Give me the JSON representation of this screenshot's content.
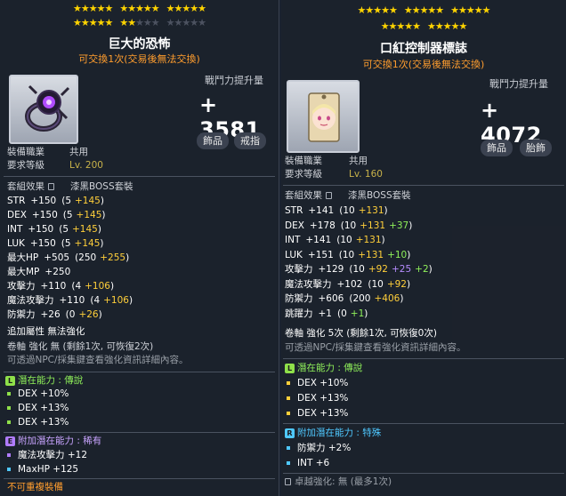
{
  "left": {
    "stars_row1": [
      "★★★★★",
      "★★★★★",
      "★★★★★"
    ],
    "stars_row2_on": [
      "★★★★★",
      "★★"
    ],
    "stars_row2_off": [
      "★★★",
      "★★★★★"
    ],
    "title": "巨大的恐怖",
    "trade_note": "可交換1次(交易後無法交換)",
    "icon": "ring-icon",
    "cp_label": "戰鬥力提升量",
    "cp_value": "+ 3581",
    "tags": [
      "飾品",
      "戒指"
    ],
    "job_label": "裝備職業",
    "job_value": "共用",
    "level_label": "要求等級",
    "level_value": "Lv. 200",
    "set_label": "套組效果",
    "set_value": "漆黑BOSS套裝",
    "stats": [
      {
        "name": "STR",
        "total": "+150",
        "base": "(5",
        "bonus": "+145",
        "extra": "",
        "close": ")"
      },
      {
        "name": "DEX",
        "total": "+150",
        "base": "(5",
        "bonus": "+145",
        "extra": "",
        "close": ")"
      },
      {
        "name": "INT",
        "total": "+150",
        "base": "(5",
        "bonus": "+145",
        "extra": "",
        "close": ")"
      },
      {
        "name": "LUK",
        "total": "+150",
        "base": "(5",
        "bonus": "+145",
        "extra": "",
        "close": ")"
      },
      {
        "name": "最大HP",
        "total": "+505",
        "base": "(250",
        "bonus": "+255",
        "extra": "",
        "close": ")"
      },
      {
        "name": "最大MP",
        "total": "+250",
        "base": "",
        "bonus": "",
        "extra": "",
        "close": ""
      },
      {
        "name": "攻擊力",
        "total": "+110",
        "base": "(4",
        "bonus": "+106",
        "extra": "",
        "close": ")"
      },
      {
        "name": "魔法攻擊力",
        "total": "+110",
        "base": "(4",
        "bonus": "+106",
        "extra": "",
        "close": ")"
      },
      {
        "name": "防禦力",
        "total": "+26",
        "base": "(0",
        "bonus": "+26",
        "extra": "",
        "close": ")"
      }
    ],
    "extra_attr": "追加屬性 無法強化",
    "scroll_line": "卷軸 強化 無 (剩餘1次, 可恢復2次)",
    "npc_note": "可透過NPC/採集鍵查看強化資訊詳細內容。",
    "potential": {
      "badge": "L",
      "label": "潛在能力 : 傳說",
      "lines": [
        "DEX +10%",
        "DEX +13%",
        "DEX +13%"
      ]
    },
    "bonus_potential": {
      "badge": "E",
      "label": "附加潛在能力 : 稀有",
      "lines": [
        "魔法攻擊力 +12",
        "MaxHP +125"
      ]
    },
    "footer": "不可重複裝備"
  },
  "right": {
    "stars_row1": [
      "★★★★★",
      "★★★★★",
      "★★★★★"
    ],
    "stars_row2_on": [
      "★★★★★",
      "★★★★★"
    ],
    "stars_row2_off": [],
    "title": "口紅控制器標誌",
    "trade_note": "可交換1次(交易後無法交換)",
    "icon": "emblem-icon",
    "cp_label": "戰鬥力提升量",
    "cp_value": "+ 4072",
    "tags": [
      "飾品",
      "胎飾"
    ],
    "job_label": "裝備職業",
    "job_value": "共用",
    "level_label": "要求等級",
    "level_value": "Lv. 160",
    "set_label": "套組效果",
    "set_value": "漆黑BOSS套裝",
    "stats": [
      {
        "name": "STR",
        "total": "+141",
        "base": "(10",
        "bonus": "+131",
        "extra": "",
        "extra2": "",
        "close": ")"
      },
      {
        "name": "DEX",
        "total": "+178",
        "base": "(10",
        "bonus": "+131",
        "extra": "+37",
        "extra2": "",
        "close": ")"
      },
      {
        "name": "INT",
        "total": "+141",
        "base": "(10",
        "bonus": "+131",
        "extra": "",
        "extra2": "",
        "close": ")"
      },
      {
        "name": "LUK",
        "total": "+151",
        "base": "(10",
        "bonus": "+131",
        "extra": "+10",
        "extra2": "",
        "close": ")"
      },
      {
        "name": "攻擊力",
        "total": "+129",
        "base": "(10",
        "bonus": "+92",
        "extra": "+25",
        "extra2": "+2",
        "close": ")"
      },
      {
        "name": "魔法攻擊力",
        "total": "+102",
        "base": "(10",
        "bonus": "+92",
        "extra": "",
        "extra2": "",
        "close": ")"
      },
      {
        "name": "防禦力",
        "total": "+606",
        "base": "(200",
        "bonus": "+406",
        "extra": "",
        "extra2": "",
        "close": ")"
      },
      {
        "name": "跳躍力",
        "total": "+1",
        "base": "(0",
        "bonus": "",
        "extra": "+1",
        "extra2": "",
        "close": ")"
      }
    ],
    "scroll_line": "卷軸 強化 5次 (剩餘1次, 可恢復0次)",
    "npc_note": "可透過NPC/採集鍵查看強化資訊詳細內容。",
    "potential": {
      "badge": "L",
      "label": "潛在能力 : 傳說",
      "lines": [
        "DEX +10%",
        "DEX +13%",
        "DEX +13%"
      ]
    },
    "bonus_potential": {
      "badge": "R",
      "label": "附加潛在能力 : 特殊",
      "lines": [
        "防禦力 +2%",
        "INT +6"
      ]
    },
    "footer": "卓越強化: 無 (最多1次)"
  },
  "colors": {
    "legendary": "#8fe04a",
    "epic": "#b07cff",
    "rare": "#4fc8ff",
    "orange": "#ff9d2e",
    "yellow": "#ffcf3a"
  }
}
